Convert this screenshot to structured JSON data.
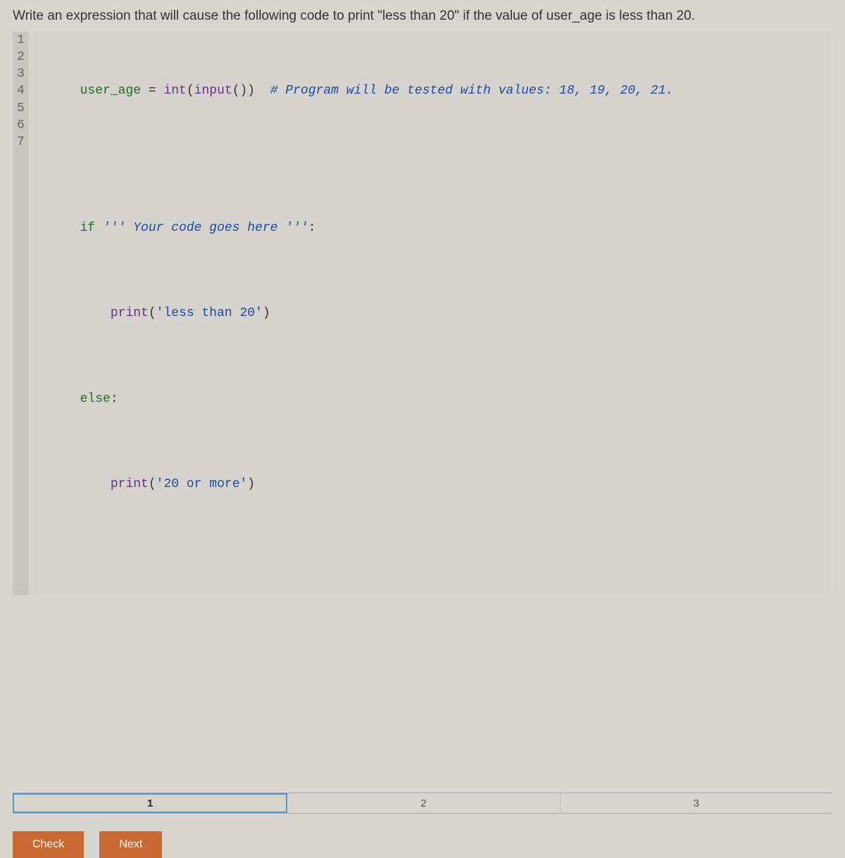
{
  "prompt": "Write an expression that will cause the following code to print \"less than 20\" if the value of user_age is less than 20.",
  "code": {
    "lines": [
      "1",
      "2",
      "3",
      "4",
      "5",
      "6",
      "7"
    ],
    "l1": {
      "var": "user_age",
      "eq": " = ",
      "fn": "int",
      "lp": "(",
      "fn2": "input",
      "paren": "())",
      "sp": "  ",
      "comment": "# Program will be tested with values: 18, 19, 20, 21."
    },
    "l3": {
      "kw": "if",
      "sp": " ",
      "ph": "''' Your code goes here '''",
      "colon": ":"
    },
    "l4": {
      "indent": "    ",
      "fn": "print",
      "lp": "(",
      "str": "'less than 20'",
      "rp": ")"
    },
    "l5": {
      "kw": "else",
      "colon": ":"
    },
    "l6": {
      "indent": "    ",
      "fn": "print",
      "lp": "(",
      "str": "'20 or more'",
      "rp": ")"
    }
  },
  "pager": {
    "step1": "1",
    "step2": "2",
    "step3": "3"
  },
  "buttons": {
    "check": "Check",
    "next": "Next"
  }
}
